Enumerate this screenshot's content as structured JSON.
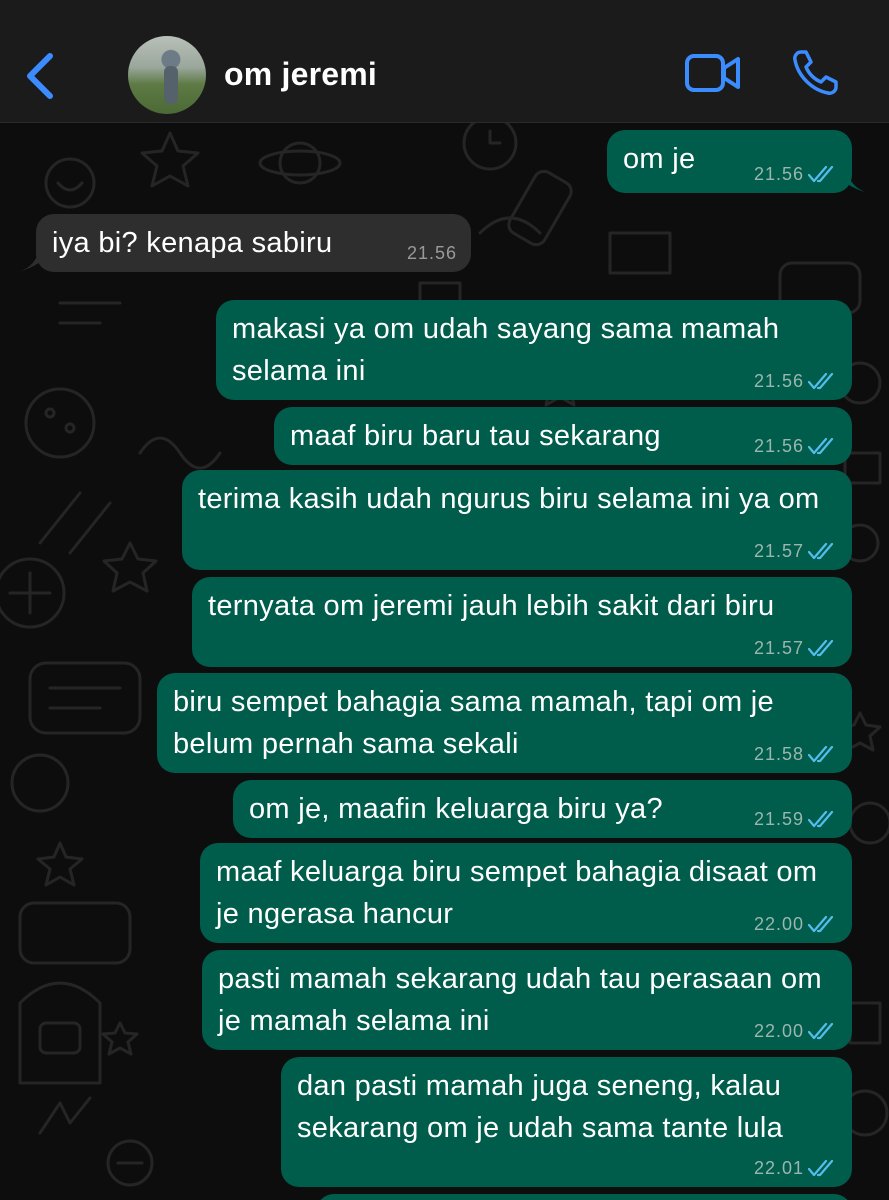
{
  "header": {
    "contact_name": "om jeremi"
  },
  "icons": {
    "back": "chevron-left-icon",
    "video": "video-camera-icon",
    "call": "phone-icon",
    "read": "double-check-icon"
  },
  "colors": {
    "accent": "#3b8cff",
    "outgoing_bubble": "#005c4b",
    "incoming_bubble": "#2e2e2e",
    "header_bg": "#1b1b1b",
    "read_ticks": "#53bdeb"
  },
  "messages": [
    {
      "direction": "out",
      "text": "om je",
      "time": "21.56"
    },
    {
      "direction": "in",
      "text": "iya bi? kenapa sabiru",
      "time": "21.56"
    },
    {
      "direction": "out",
      "text": "makasi ya om udah sayang sama mamah selama ini",
      "time": "21.56"
    },
    {
      "direction": "out",
      "text": "maaf biru baru tau sekarang",
      "time": "21.56"
    },
    {
      "direction": "out",
      "text": "terima kasih udah ngurus biru selama ini ya om",
      "time": "21.57"
    },
    {
      "direction": "out",
      "text": "ternyata om jeremi jauh lebih sakit dari biru",
      "time": "21.57"
    },
    {
      "direction": "out",
      "text": "biru sempet bahagia sama mamah, tapi om je belum pernah sama sekali",
      "time": "21.58"
    },
    {
      "direction": "out",
      "text": "om je, maafin keluarga biru ya?",
      "time": "21.59"
    },
    {
      "direction": "out",
      "text": "maaf keluarga biru sempet bahagia disaat om je ngerasa hancur",
      "time": "22.00"
    },
    {
      "direction": "out",
      "text": "pasti mamah sekarang udah tau perasaan om je mamah selama ini",
      "time": "22.00"
    },
    {
      "direction": "out",
      "text": "dan pasti mamah juga seneng, kalau sekarang om je udah sama tante lula",
      "time": "22.01"
    }
  ]
}
